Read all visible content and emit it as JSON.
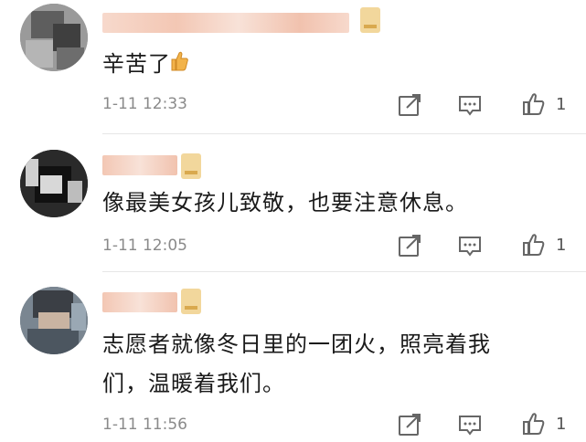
{
  "comments": [
    {
      "text": "辛苦了",
      "emoji": "thumbs-up-emoji",
      "time": "1-11 12:33",
      "likes": "1"
    },
    {
      "text": "像最美女孩儿致敬，也要注意休息。",
      "time": "1-11 12:05",
      "likes": "1"
    },
    {
      "text_line1": "志愿者就像冬日里的一团火，照亮着我",
      "text_line2": "们，温暖着我们。",
      "time": "1-11 11:56",
      "likes": "1"
    }
  ],
  "colors": {
    "text": "#1a1a1a",
    "meta": "#8a8a8a",
    "icon": "#666666",
    "badge": "#f2d79c"
  }
}
